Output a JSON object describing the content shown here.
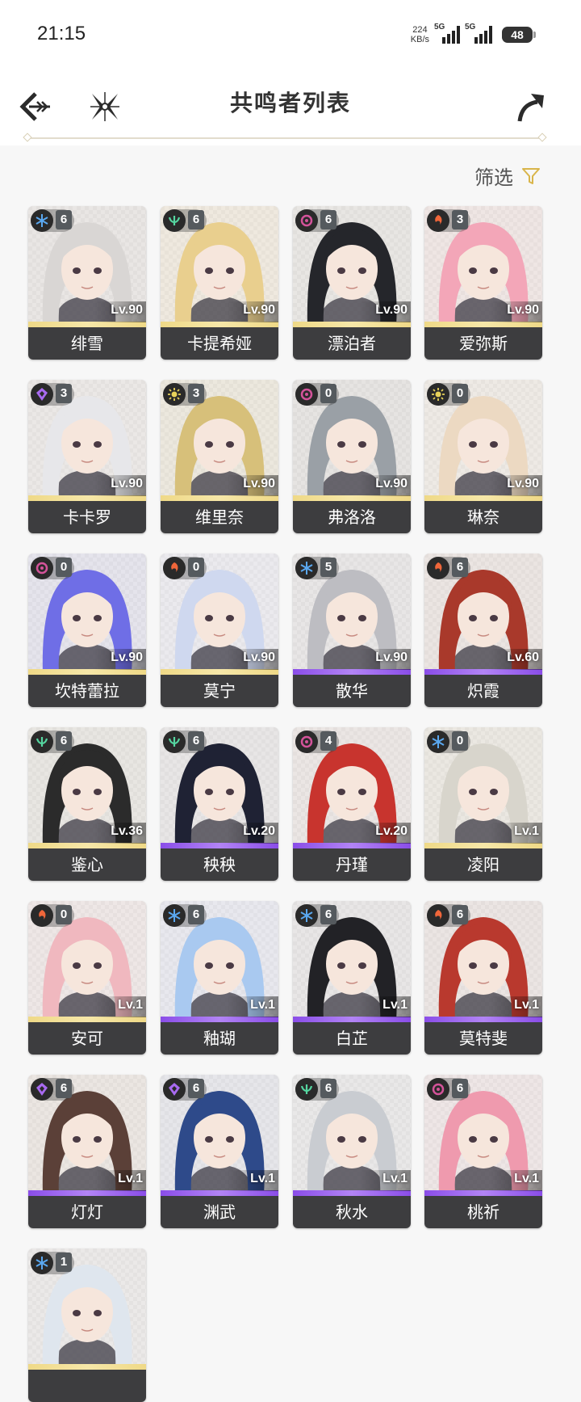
{
  "status_bar": {
    "time": "21:15",
    "net_speed_value": "224",
    "net_speed_unit": "KB/s",
    "signal1": "5G",
    "signal2": "5G",
    "battery": "48"
  },
  "header": {
    "title": "共鸣者列表",
    "filter_label": "筛选"
  },
  "colors": {
    "glacio": "#5aa8f0",
    "aero": "#55d6a0",
    "havoc": "#d4539a",
    "fusion": "#f0663a",
    "electro": "#a86af0",
    "spectro": "#e8d25a",
    "rarity5": "#efd987",
    "rarity4": "#9b62ec"
  },
  "characters": [
    {
      "name": "绯雪",
      "level": "Lv.90",
      "chain": "6",
      "element": "glacio",
      "rarity": 5,
      "hair": "#d9d6d4",
      "bg": "#e9e6e4"
    },
    {
      "name": "卡提希娅",
      "level": "Lv.90",
      "chain": "6",
      "element": "aero",
      "rarity": 5,
      "hair": "#e9cf8e",
      "bg": "#efe9df"
    },
    {
      "name": "漂泊者",
      "level": "Lv.90",
      "chain": "6",
      "element": "havoc",
      "rarity": 5,
      "hair": "#25262b",
      "bg": "#e8e6e3"
    },
    {
      "name": "爱弥斯",
      "level": "Lv.90",
      "chain": "3",
      "element": "fusion",
      "rarity": 5,
      "hair": "#f3a6b8",
      "bg": "#efe6e4"
    },
    {
      "name": "卡卡罗",
      "level": "Lv.90",
      "chain": "3",
      "element": "electro",
      "rarity": 5,
      "hair": "#e7e7ea",
      "bg": "#ebe8e6"
    },
    {
      "name": "维里奈",
      "level": "Lv.90",
      "chain": "3",
      "element": "spectro",
      "rarity": 5,
      "hair": "#d7c07a",
      "bg": "#ece8de"
    },
    {
      "name": "弗洛洛",
      "level": "Lv.90",
      "chain": "0",
      "element": "havoc",
      "rarity": 5,
      "hair": "#9aa0a6",
      "bg": "#e6e4e2"
    },
    {
      "name": "琳奈",
      "level": "Lv.90",
      "chain": "0",
      "element": "spectro",
      "rarity": 5,
      "hair": "#ecd9c2",
      "bg": "#eeeae5"
    },
    {
      "name": "坎特蕾拉",
      "level": "Lv.90",
      "chain": "0",
      "element": "havoc",
      "rarity": 5,
      "hair": "#6f6ee6",
      "bg": "#e5e4ec"
    },
    {
      "name": "莫宁",
      "level": "Lv.90",
      "chain": "0",
      "element": "fusion",
      "rarity": 5,
      "hair": "#cfd8ef",
      "bg": "#ebeaee"
    },
    {
      "name": "散华",
      "level": "Lv.90",
      "chain": "5",
      "element": "glacio",
      "rarity": 4,
      "hair": "#bdbdc2",
      "bg": "#e8e6e6"
    },
    {
      "name": "炽霞",
      "level": "Lv.60",
      "chain": "6",
      "element": "fusion",
      "rarity": 4,
      "hair": "#a9392b",
      "bg": "#ebe5e2"
    },
    {
      "name": "鉴心",
      "level": "Lv.36",
      "chain": "6",
      "element": "aero",
      "rarity": 5,
      "hair": "#2b2b2b",
      "bg": "#e8e6e2"
    },
    {
      "name": "秧秧",
      "level": "Lv.20",
      "chain": "6",
      "element": "aero",
      "rarity": 4,
      "hair": "#1f2234",
      "bg": "#e8e6e6"
    },
    {
      "name": "丹瑾",
      "level": "Lv.20",
      "chain": "4",
      "element": "havoc",
      "rarity": 4,
      "hair": "#c8342e",
      "bg": "#ebe6e4"
    },
    {
      "name": "凌阳",
      "level": "Lv.1",
      "chain": "0",
      "element": "glacio",
      "rarity": 5,
      "hair": "#d8d5cc",
      "bg": "#ebe8e2"
    },
    {
      "name": "安可",
      "level": "Lv.1",
      "chain": "0",
      "element": "fusion",
      "rarity": 5,
      "hair": "#f0b8bf",
      "bg": "#eee7e6"
    },
    {
      "name": "釉瑚",
      "level": "Lv.1",
      "chain": "6",
      "element": "glacio",
      "rarity": 4,
      "hair": "#a9c9f0",
      "bg": "#e8e8ee"
    },
    {
      "name": "白芷",
      "level": "Lv.1",
      "chain": "6",
      "element": "glacio",
      "rarity": 4,
      "hair": "#222226",
      "bg": "#e8e6e6"
    },
    {
      "name": "莫特斐",
      "level": "Lv.1",
      "chain": "6",
      "element": "fusion",
      "rarity": 4,
      "hair": "#b9392e",
      "bg": "#ebe5e3"
    },
    {
      "name": "灯灯",
      "level": "Lv.1",
      "chain": "6",
      "element": "electro",
      "rarity": 4,
      "hair": "#5b4038",
      "bg": "#ebe6e2"
    },
    {
      "name": "渊武",
      "level": "Lv.1",
      "chain": "6",
      "element": "electro",
      "rarity": 4,
      "hair": "#2e4a8a",
      "bg": "#e6e6ea"
    },
    {
      "name": "秋水",
      "level": "Lv.1",
      "chain": "6",
      "element": "aero",
      "rarity": 4,
      "hair": "#c9ccd1",
      "bg": "#e9e8e8"
    },
    {
      "name": "桃祈",
      "level": "Lv.1",
      "chain": "6",
      "element": "havoc",
      "rarity": 4,
      "hair": "#ef9aae",
      "bg": "#eee6e6"
    },
    {
      "name": "",
      "level": "",
      "chain": "1",
      "element": "glacio",
      "rarity": 5,
      "hair": "#dfe6ee",
      "bg": "#ebe9e8"
    }
  ]
}
